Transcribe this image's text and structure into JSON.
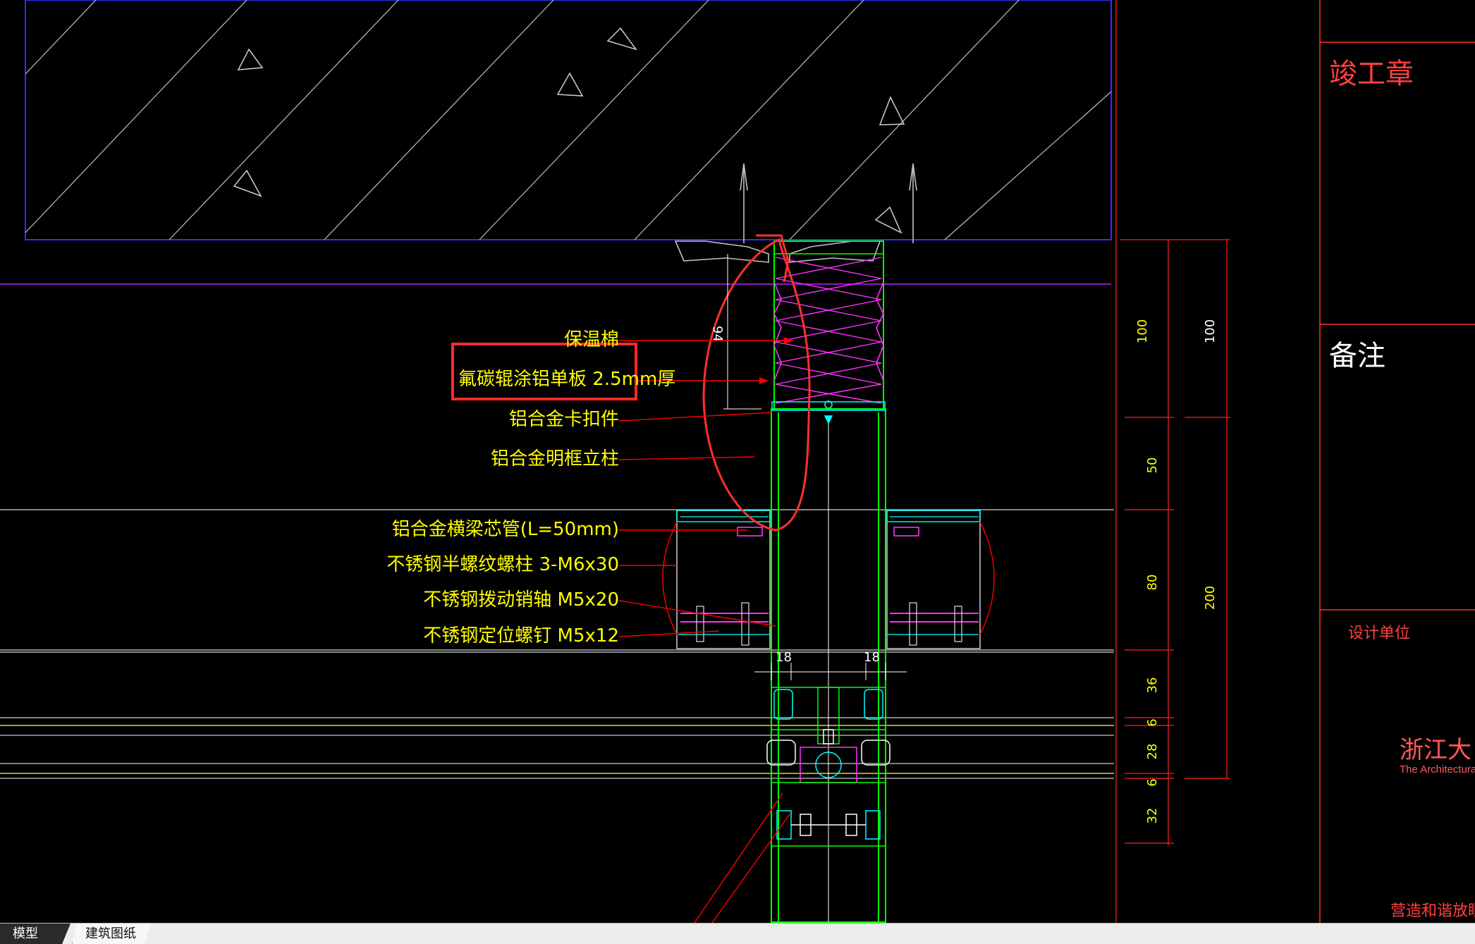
{
  "labels": {
    "insulation": "保温棉",
    "panel": "氟碳辊涂铝单板 2.5mm厚",
    "clip": "铝合金卡扣件",
    "mullion": "铝合金明框立柱",
    "sleeve": "铝合金横梁芯管(L=50mm)",
    "bolt": "不锈钢半螺纹螺柱 3-M6x30",
    "pin": "不锈钢拨动销轴 M5x20",
    "screw": "不锈钢定位螺钉 M5x12"
  },
  "dimensions": {
    "d94": "94",
    "w18_left": "18",
    "w18_right": "18",
    "v100_a": "100",
    "v100_b": "100",
    "v50": "50",
    "v80": "80",
    "v200": "200",
    "v36": "36",
    "v6_a": "6",
    "v28": "28",
    "v6_b": "6",
    "v32": "32"
  },
  "title_block": {
    "completion_stamp": "竣工章",
    "remarks": "备注",
    "design_unit": "设计单位",
    "brand_cn": "浙江大",
    "brand_en": "The Architectura",
    "footer_left": "营造和谐",
    "footer_right": "放眼"
  },
  "tabs": [
    {
      "label": "模型",
      "active": true
    },
    {
      "label": "建筑图纸",
      "active": false
    }
  ],
  "colors": {
    "background": "#000000",
    "annotation_text": "#ffff00",
    "leader_line": "#ff0000",
    "profile": "#00ff00",
    "insulation": "#ff00ff",
    "cyan_detail": "#00ffff",
    "slab_outline": "#0000ff",
    "highlight_box": "#ff2a2a",
    "title_block_line": "#ff3030",
    "brand": "#ff5a5a"
  }
}
